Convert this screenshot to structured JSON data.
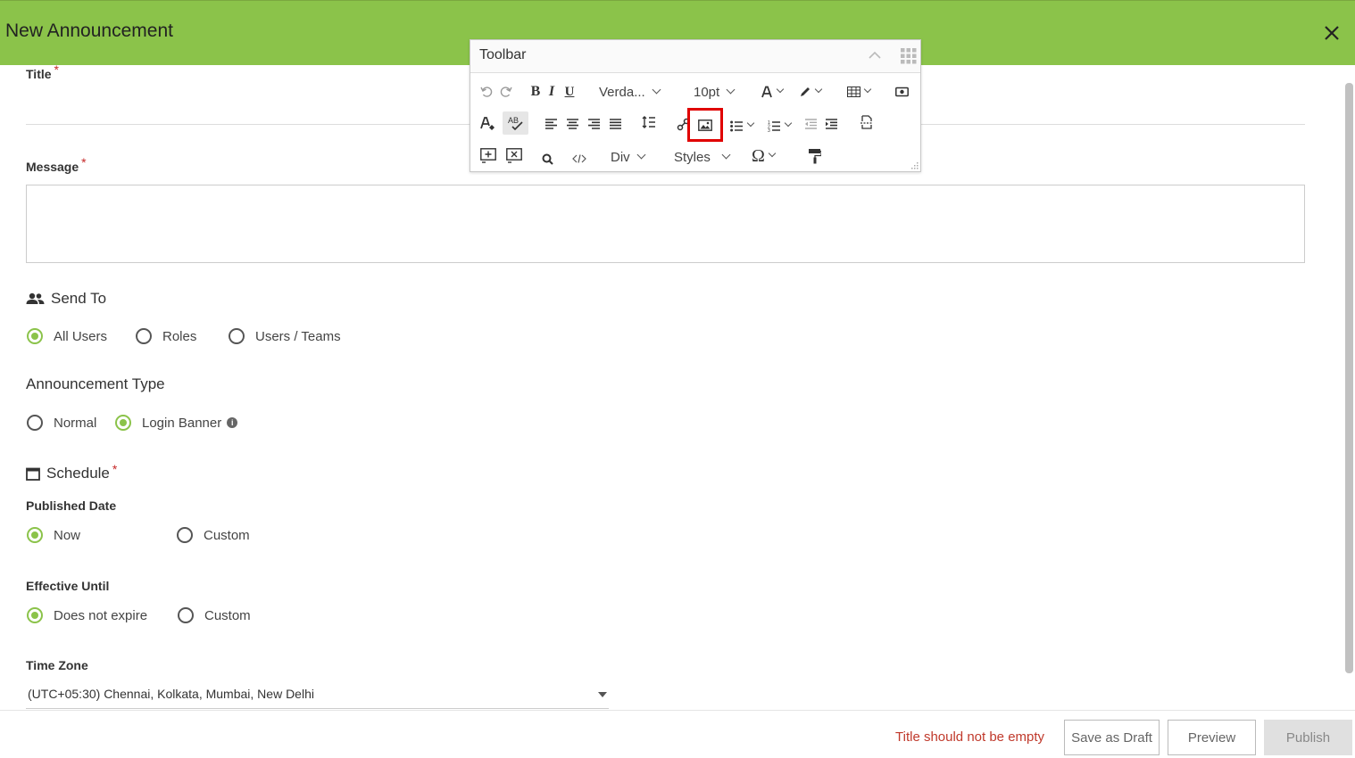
{
  "header": {
    "title": "New Announcement"
  },
  "form": {
    "title_label": "Title",
    "message_label": "Message",
    "send_to": {
      "heading": "Send To",
      "options": [
        "All Users",
        "Roles",
        "Users / Teams"
      ],
      "selected": "All Users"
    },
    "announcement_type": {
      "heading": "Announcement Type",
      "options": [
        "Normal",
        "Login Banner"
      ],
      "selected": "Login Banner"
    },
    "schedule": {
      "heading": "Schedule",
      "published_date": {
        "label": "Published Date",
        "options": [
          "Now",
          "Custom"
        ],
        "selected": "Now"
      },
      "effective_until": {
        "label": "Effective Until",
        "options": [
          "Does not expire",
          "Custom"
        ],
        "selected": "Does not expire"
      }
    },
    "time_zone": {
      "label": "Time Zone",
      "value": "(UTC+05:30) Chennai, Kolkata, Mumbai, New Delhi"
    }
  },
  "toolbar": {
    "title": "Toolbar",
    "font_family": "Verda...",
    "font_size": "10pt",
    "block_format": "Div",
    "styles": "Styles",
    "highlighted_tool": "insert-image",
    "colors": {
      "highlight": "#e00000"
    }
  },
  "footer": {
    "error": "Title should not be empty",
    "save_draft": "Save as Draft",
    "preview": "Preview",
    "publish": "Publish"
  },
  "colors": {
    "accent": "#8bc34a",
    "error": "#c0392b",
    "required": "#c62828"
  }
}
